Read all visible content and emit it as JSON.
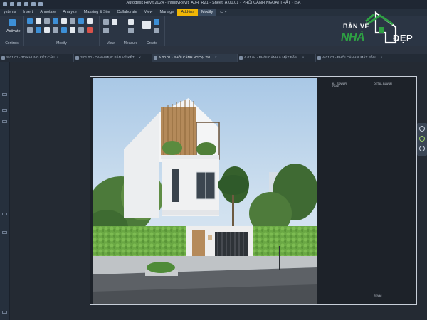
{
  "window": {
    "title": "Autodesk Revit 2024 - InfinityRevit_A0H_R21 - Sheet: A.00.01 - PHỐI CẢNH NGOẠI THẤT - ISA"
  },
  "menu": {
    "items": [
      "ystems",
      "Insert",
      "Annotate",
      "Analyze",
      "Massing & Site",
      "Collaborate",
      "View",
      "Manage",
      "Add-ins",
      "Modify"
    ],
    "active_index": 8,
    "modify_index": 9
  },
  "ribbon": {
    "panels": [
      {
        "label": "Controls",
        "tool_text": "Activate"
      },
      {
        "label": "Modify"
      },
      {
        "label": "View"
      },
      {
        "label": "Measure"
      },
      {
        "label": "Create"
      }
    ]
  },
  "logo": {
    "line1": "BẢN VẼ",
    "line2": "NHÀ",
    "line3": "ĐẸP",
    "colors": {
      "green": "#2ea043",
      "white": "#ffffff"
    }
  },
  "tabs": [
    {
      "label": "S.01.01 - 3D KHUNG KẾT CẤU",
      "close": "×"
    },
    {
      "label": "3.01.00 - DANH MỤC BẢN VẼ KẾT...",
      "close": "×"
    },
    {
      "label": "A.00.01 - PHỐI CẢNH NGOẠI TH...",
      "close": "×"
    },
    {
      "label": "A.01.04 - PHỐI CẢNH & MẶT BẰN...",
      "close": "×"
    },
    {
      "label": "A.01.03 - PHỐI CẢNH & MẶT BẰN...",
      "close": "×"
    }
  ],
  "active_tab_index": 2,
  "sheet": {
    "labels": {
      "top_left": "KL_SDWUR\nDATE",
      "top_right": "DETAIL BLWUR",
      "bottom": "REV##"
    }
  },
  "colors": {
    "accent_tab": "#f2b705",
    "app_bg": "#2b3340",
    "canvas_bg": "#242a33"
  }
}
